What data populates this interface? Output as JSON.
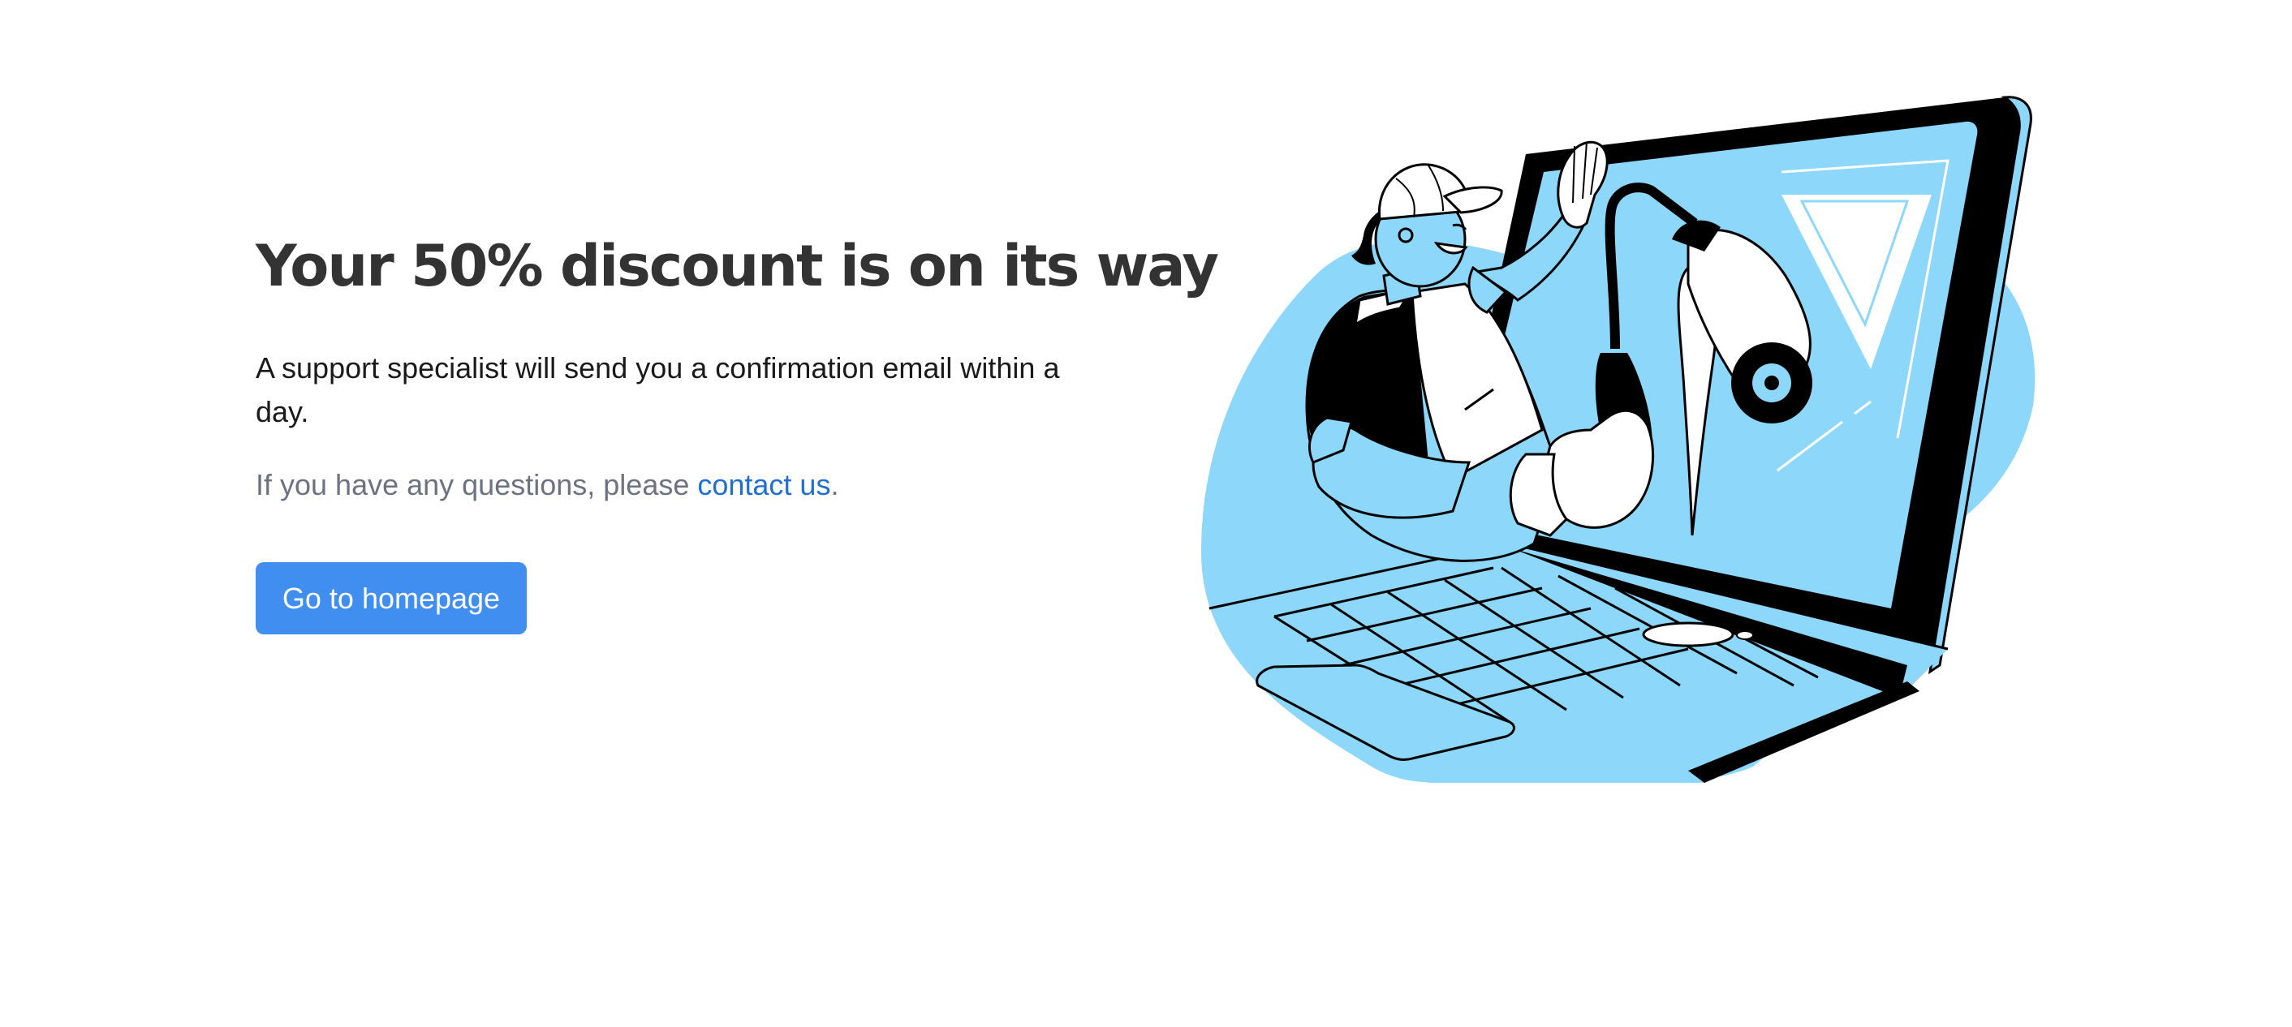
{
  "page": {
    "headline": "Your 50% discount is on its way",
    "body": "A support specialist will send you a confirmation email within a day.",
    "help_prefix": "If you have any questions, please ",
    "help_link": "contact us",
    "help_suffix": ".",
    "cta_label": "Go to homepage"
  },
  "illustration": {
    "subject": "worker painting a laptop screen with a paint roller",
    "icons": [
      "laptop-icon",
      "paint-roller-icon",
      "worker-icon"
    ]
  },
  "colors": {
    "background": "#ffffff",
    "headline": "#333333",
    "body": "#1a1a1a",
    "muted": "#6b7280",
    "link": "#1f6fd1",
    "button": "#3f8ef0",
    "button_text": "#ffffff",
    "illustration_blue": "#8dd7fb",
    "illustration_outline": "#000000"
  }
}
